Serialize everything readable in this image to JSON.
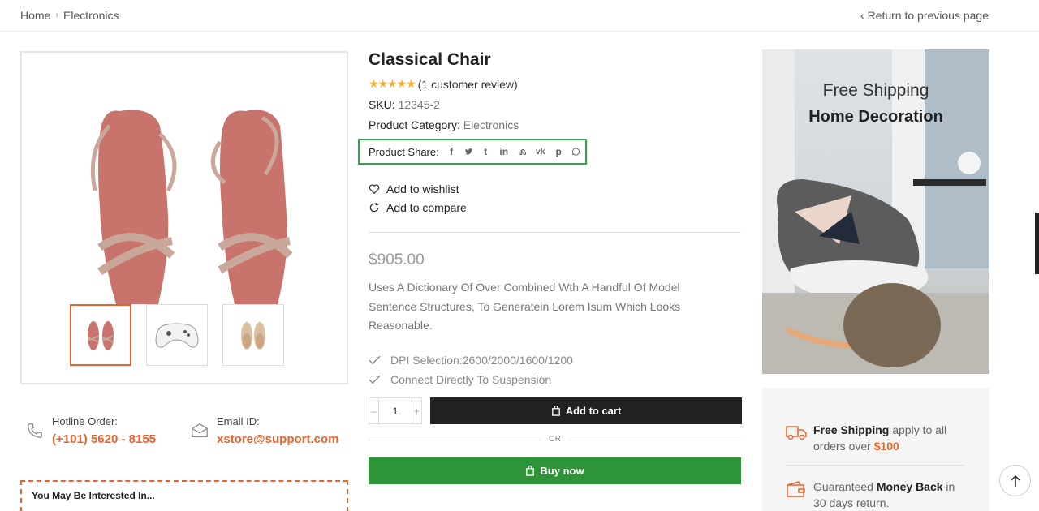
{
  "breadcrumb": {
    "home": "Home",
    "separator": "›",
    "current": "Electronics"
  },
  "return_link": {
    "chevron": "‹",
    "label": "Return to previous page"
  },
  "gallery": {
    "thumbnails": [
      "sandals-thumbnail",
      "controller-thumbnail",
      "flats-thumbnail"
    ]
  },
  "contact": {
    "hotline_label": "Hotline Order:",
    "hotline_value": "(+101) 5620 - 8155",
    "email_label": "Email ID:",
    "email_value": "xstore@support.com"
  },
  "interested": {
    "label": "You May Be Interested In..."
  },
  "product": {
    "title": "Classical Chair",
    "stars": "★★★★★",
    "review_text": "(1 customer review)",
    "sku_label": "SKU:",
    "sku_value": "12345-2",
    "category_label": "Product Category:",
    "category_value": "Electronics",
    "share_label": "Product Share:",
    "share_icons": [
      "facebook-icon",
      "twitter-icon",
      "tumblr-icon",
      "linkedin-icon",
      "stumbleupon-icon",
      "vk-icon",
      "pinterest-icon",
      "whatsapp-icon"
    ],
    "wishlist_label": "Add to wishlist",
    "compare_label": "Add to compare",
    "price": "$905.00",
    "description": "Uses A Dictionary Of Over Combined Wth A Handful Of Model Sentence Structures, To Generatein Lorem Isum Which Looks Reasonable.",
    "features": [
      "DPI Selection:2600/2000/1600/1200",
      "Connect Directly To Suspension"
    ],
    "quantity": "1",
    "minus": "–",
    "plus": "+",
    "add_to_cart": "Add to cart",
    "or_text": "OR",
    "buy_now": "Buy now"
  },
  "promo": {
    "line1": "Free Shipping",
    "line2": "Home Decoration"
  },
  "services": {
    "shipping_strong": "Free Shipping",
    "shipping_text": " apply to all orders over ",
    "shipping_amount": "$100",
    "money_pre": "Guaranteed ",
    "money_strong": "Money Back",
    "money_text": " in 30 days return."
  },
  "colors": {
    "accent": "#e8622b",
    "buy_green": "#2e9438",
    "highlight_green": "#27a745",
    "star": "#f3b02e",
    "dark": "#222222"
  }
}
